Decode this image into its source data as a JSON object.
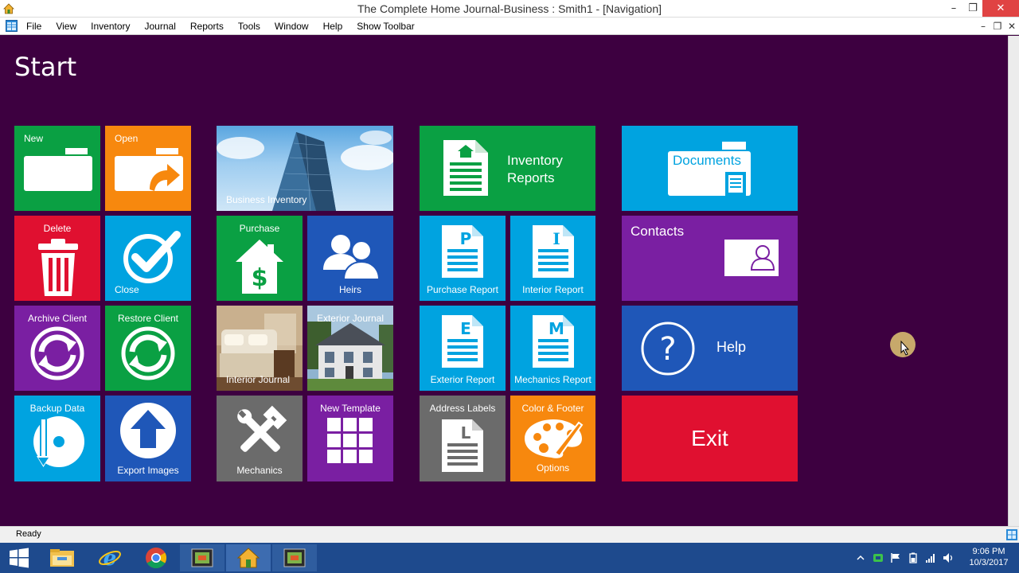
{
  "window": {
    "title": "The Complete Home Journal-Business : Smith1 - [Navigation]",
    "min_glyph": "–",
    "max_glyph": "❐",
    "close_glyph": "✕"
  },
  "menu": {
    "items": [
      "File",
      "View",
      "Inventory",
      "Journal",
      "Reports",
      "Tools",
      "Window",
      "Help",
      "Show Toolbar"
    ],
    "mdi_min": "–",
    "mdi_restore": "❐",
    "mdi_close": "✕"
  },
  "start": {
    "title": "Start"
  },
  "tiles": {
    "new": {
      "label": "New",
      "color": "#0aa043",
      "icon": "folder-icon"
    },
    "open": {
      "label": "Open",
      "color": "#f7880e",
      "icon": "folder-open-arrow-icon"
    },
    "delete": {
      "label": "Delete",
      "color": "#e01030",
      "icon": "trash-icon"
    },
    "close": {
      "label": "Close",
      "color": "#00a3e0",
      "icon": "checkmark-icon"
    },
    "archive": {
      "label": "Archive Client",
      "color": "#7a1fa2",
      "icon": "sync-icon"
    },
    "restore": {
      "label": "Restore Client",
      "color": "#0aa043",
      "icon": "sync-icon"
    },
    "backup": {
      "label": "Backup Data",
      "color": "#00a3e0",
      "icon": "disc-icon"
    },
    "export": {
      "label": "Export Images",
      "color": "#1f57b8",
      "icon": "upload-arrow-icon"
    },
    "business_inventory": {
      "label": "Business Inventory",
      "icon": "skyscraper-photo"
    },
    "purchase": {
      "label": "Purchase",
      "color": "#0aa043",
      "icon": "house-dollar-icon"
    },
    "heirs": {
      "label": "Heirs",
      "color": "#1f57b8",
      "icon": "people-icon"
    },
    "interior_journal": {
      "label": "Interior Journal",
      "icon": "bedroom-photo"
    },
    "exterior_journal": {
      "label": "Exterior Journal",
      "icon": "house-photo"
    },
    "mechanics": {
      "label": "Mechanics",
      "color": "#6b6b6b",
      "icon": "tools-icon"
    },
    "new_template": {
      "label": "New Template",
      "color": "#7a1fa2",
      "icon": "grid-icon"
    },
    "inventory_reports": {
      "label_line1": "Inventory",
      "label_line2": "Reports",
      "color": "#0aa043",
      "icon": "report-house-icon"
    },
    "purchase_report": {
      "label": "Purchase Report",
      "letter": "P",
      "color": "#00a3e0"
    },
    "interior_report": {
      "label": "Interior Report",
      "letter": "I",
      "color": "#00a3e0"
    },
    "exterior_report": {
      "label": "Exterior Report",
      "letter": "E",
      "color": "#00a3e0"
    },
    "mechanics_report": {
      "label": "Mechanics Report",
      "letter": "M",
      "color": "#00a3e0"
    },
    "address_labels": {
      "label": "Address Labels",
      "letter": "L",
      "color": "#6b6b6b"
    },
    "color_footer": {
      "label_line1": "Color & Footer",
      "label_line2": "Options",
      "color": "#f7880e",
      "icon": "palette-icon"
    },
    "documents": {
      "label": "Documents",
      "color": "#00a3e0",
      "icon": "documents-folder-icon"
    },
    "contacts": {
      "label": "Contacts",
      "color": "#7a1fa2",
      "icon": "contact-card-icon"
    },
    "help": {
      "label": "Help",
      "color": "#1f57b8",
      "icon": "question-icon",
      "glyph": "?"
    },
    "exit": {
      "label": "Exit",
      "color": "#e01030"
    }
  },
  "status": {
    "text": "Ready"
  },
  "taskbar": {
    "items": [
      "windows-start-icon",
      "file-explorer-icon",
      "internet-explorer-icon",
      "chrome-icon",
      "media-app-icon",
      "home-journal-icon",
      "media-app-icon"
    ],
    "clock_time": "9:06 PM",
    "clock_date": "10/3/2017"
  }
}
